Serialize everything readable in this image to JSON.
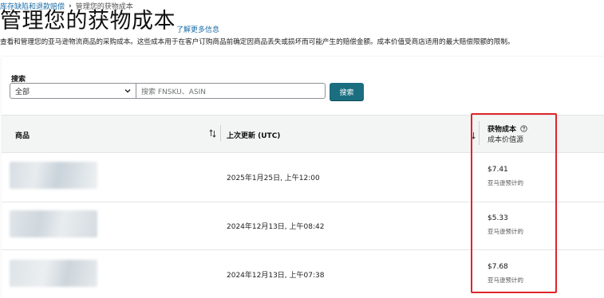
{
  "breadcrumb": {
    "parent": "库存缺陷和退款赔偿",
    "separator": "›",
    "current": "管理您的获物成本"
  },
  "page": {
    "title": "管理您的获物成本",
    "learn_more": "了解更多信息",
    "description": "查看和管理您的亚马逊物流商品的采购成本。这些成本用于在客户订购商品前确定因商品丢失或损坏而可能产生的赔偿金额。成本价值受商店适用的最大赔偿限额的限制。"
  },
  "search": {
    "label": "搜索",
    "scope_value": "全部",
    "placeholder": "搜索 FNSKU、ASIN",
    "button_label": "搜索"
  },
  "table": {
    "headers": {
      "product": "商品",
      "last_updated": "上次更新 (UTC)",
      "cost_title": "获物成本",
      "cost_subtitle": "成本价值源"
    },
    "rows": [
      {
        "date": "2025年1月25日, 上午12:00",
        "price": "$7.41",
        "source": "亚马逊预计的"
      },
      {
        "date": "2024年12月13日, 上午08:42",
        "price": "$5.33",
        "source": "亚马逊预计的"
      },
      {
        "date": "2024年12月13日, 上午07:38",
        "price": "$7.68",
        "source": "亚马逊预计的"
      }
    ]
  },
  "colors": {
    "link": "#1b6ea6",
    "search_button": "#1a6e80",
    "highlight_box": "#e0242b"
  },
  "icons": [
    "chevron-down-icon",
    "sort-icon",
    "help-icon"
  ]
}
